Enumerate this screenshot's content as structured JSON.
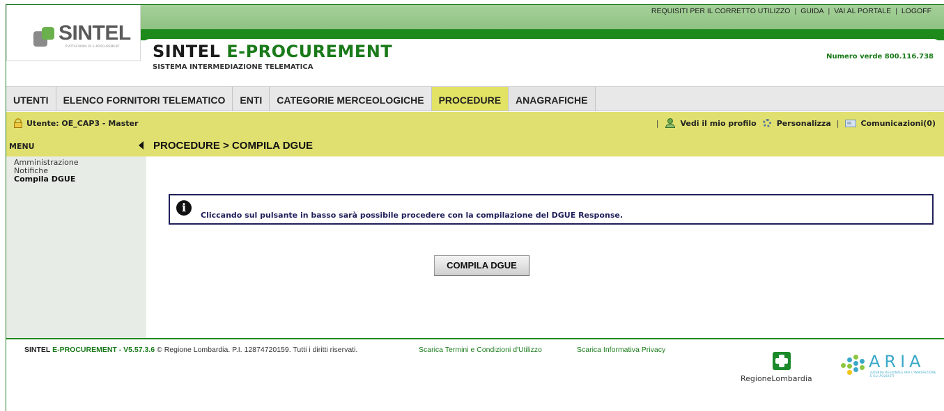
{
  "header": {
    "logo_text": "SINTEL",
    "logo_subtitle": "PIATTAFORMA DI E-PROCUREMENT",
    "title_part1": "SINTEL ",
    "title_part2": "E-PROCUREMENT",
    "subtitle": "SISTEMA INTERMEDIAZIONE TELEMATICA",
    "toll_free": "Numero verde 800.116.738",
    "top_links": [
      "REQUISITI PER IL CORRETTO UTILIZZO",
      "GUIDA",
      "VAI AL PORTALE",
      "LOGOFF"
    ]
  },
  "nav": {
    "tabs": [
      "UTENTI",
      "ELENCO FORNITORI TELEMATICO",
      "ENTI",
      "CATEGORIE MERCEOLOGICHE",
      "PROCEDURE",
      "ANAGRAFICHE"
    ],
    "active": "PROCEDURE"
  },
  "userbar": {
    "user": "Utente: OE_CAP3 - Master",
    "profile": "Vedi il mio profilo",
    "customize": "Personalizza",
    "messages": "Comunicazioni(0)"
  },
  "sidebar": {
    "title": "MENU",
    "items": [
      "Amministrazione",
      "Notifiche",
      "Compila DGUE"
    ],
    "current": "Compila DGUE"
  },
  "content": {
    "breadcrumb": "PROCEDURE  > COMPILA DGUE",
    "info_message": "Cliccando sul pulsante in basso sarà possibile procedere con la compilazione del DGUE Response.",
    "button_label": "COMPILA DGUE"
  },
  "footer": {
    "brand1": "SINTEL ",
    "brand2": "E-PROCUREMENT",
    "version": " - V5.57.3.6",
    "copyright": " © Regione Lombardia. P.I. 12874720159. Tutti i diritti riservati.",
    "link_terms": "Scarica Termini e Condizioni d'Utilizzo",
    "link_privacy": "Scarica Informativa Privacy",
    "logo_rl": "RegioneLombardia",
    "logo_aria": "ARIA",
    "logo_aria_sub": "AZIENDA REGIONALE PER L'INNOVAZIONE E GLI ACQUISTI"
  },
  "colors": {
    "brand_green": "#1f8a1c",
    "bar_yellow": "#e0e070",
    "active_tab": "#e2e264",
    "info_border": "#1f1f5a"
  }
}
